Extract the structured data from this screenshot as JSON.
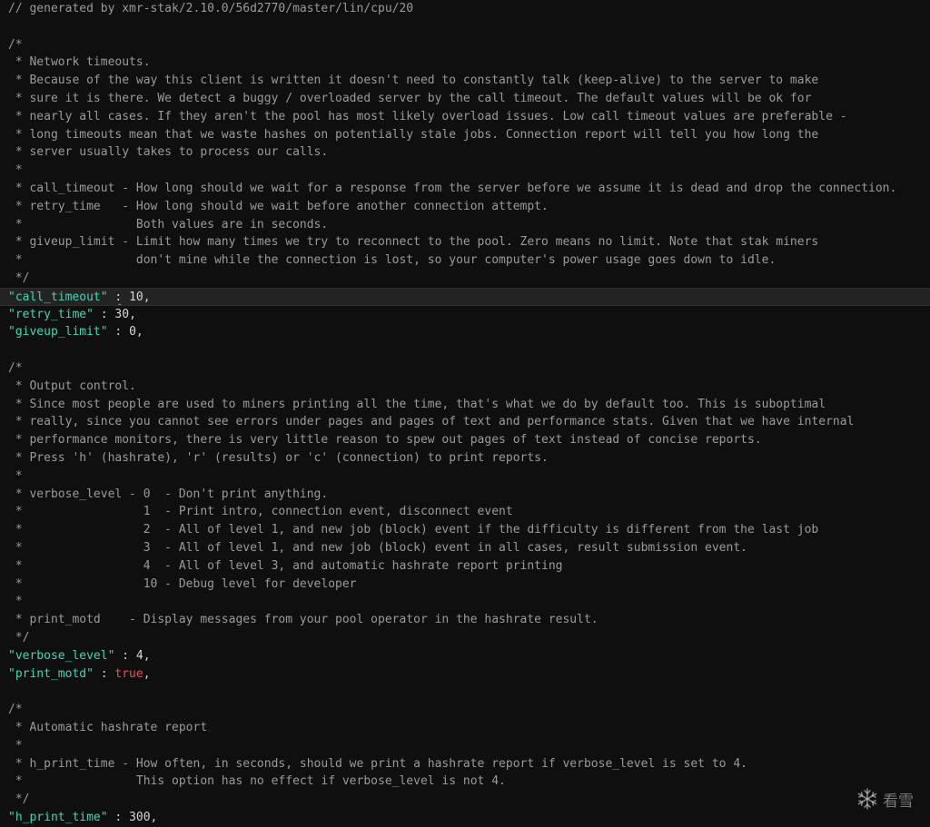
{
  "lines": [
    {
      "y": 0,
      "parts": [
        {
          "cls": "cmt",
          "text": "// generated by xmr-stak/2.10.0/56d2770/master/lin/cpu/20"
        }
      ]
    },
    {
      "y": 2,
      "parts": [
        {
          "cls": "cmt",
          "text": "/*"
        }
      ]
    },
    {
      "y": 3,
      "parts": [
        {
          "cls": "cmt",
          "text": " * Network timeouts."
        }
      ]
    },
    {
      "y": 4,
      "parts": [
        {
          "cls": "cmt",
          "text": " * Because of the way this client is written it doesn't need to constantly talk (keep-alive) to the server to make"
        }
      ]
    },
    {
      "y": 5,
      "parts": [
        {
          "cls": "cmt",
          "text": " * sure it is there. We detect a buggy / overloaded server by the call timeout. The default values will be ok for"
        }
      ]
    },
    {
      "y": 6,
      "parts": [
        {
          "cls": "cmt",
          "text": " * nearly all cases. If they aren't the pool has most likely overload issues. Low call timeout values are preferable -"
        }
      ]
    },
    {
      "y": 7,
      "parts": [
        {
          "cls": "cmt",
          "text": " * long timeouts mean that we waste hashes on potentially stale jobs. Connection report will tell you how long the"
        }
      ]
    },
    {
      "y": 8,
      "parts": [
        {
          "cls": "cmt",
          "text": " * server usually takes to process our calls."
        }
      ]
    },
    {
      "y": 9,
      "parts": [
        {
          "cls": "cmt",
          "text": " *"
        }
      ]
    },
    {
      "y": 10,
      "parts": [
        {
          "cls": "cmt",
          "text": " * call_timeout - How long should we wait for a response from the server before we assume it is dead and drop the connection."
        }
      ]
    },
    {
      "y": 11,
      "parts": [
        {
          "cls": "cmt",
          "text": " * retry_time   - How long should we wait before another connection attempt."
        }
      ]
    },
    {
      "y": 12,
      "parts": [
        {
          "cls": "cmt",
          "text": " *                Both values are in seconds."
        }
      ]
    },
    {
      "y": 13,
      "parts": [
        {
          "cls": "cmt",
          "text": " * giveup_limit - Limit how many times we try to reconnect to the pool. Zero means no limit. Note that stak miners"
        }
      ]
    },
    {
      "y": 14,
      "parts": [
        {
          "cls": "cmt",
          "text": " *                don't mine while the connection is lost, so your computer's power usage goes down to idle."
        }
      ]
    },
    {
      "y": 15,
      "parts": [
        {
          "cls": "cmt",
          "text": " */"
        }
      ]
    },
    {
      "y": 16,
      "highlight": true,
      "parts": [
        {
          "cls": "key",
          "text": "\"call_timeout\""
        },
        {
          "cls": "punc",
          "text": " "
        },
        {
          "cls": "punc cursor-underline",
          "text": ":"
        },
        {
          "cls": "punc",
          "text": " "
        },
        {
          "cls": "num",
          "text": "10"
        },
        {
          "cls": "punc",
          "text": ","
        }
      ]
    },
    {
      "y": 17,
      "parts": [
        {
          "cls": "key",
          "text": "\"retry_time\""
        },
        {
          "cls": "punc",
          "text": " : "
        },
        {
          "cls": "num",
          "text": "30"
        },
        {
          "cls": "punc",
          "text": ","
        }
      ]
    },
    {
      "y": 18,
      "parts": [
        {
          "cls": "key",
          "text": "\"giveup_limit\""
        },
        {
          "cls": "punc",
          "text": " : "
        },
        {
          "cls": "num",
          "text": "0"
        },
        {
          "cls": "punc",
          "text": ","
        }
      ]
    },
    {
      "y": 20,
      "parts": [
        {
          "cls": "cmt",
          "text": "/*"
        }
      ]
    },
    {
      "y": 21,
      "parts": [
        {
          "cls": "cmt",
          "text": " * Output control."
        }
      ]
    },
    {
      "y": 22,
      "parts": [
        {
          "cls": "cmt",
          "text": " * Since most people are used to miners printing all the time, that's what we do by default too. This is suboptimal"
        }
      ]
    },
    {
      "y": 23,
      "parts": [
        {
          "cls": "cmt",
          "text": " * really, since you cannot see errors under pages and pages of text and performance stats. Given that we have internal"
        }
      ]
    },
    {
      "y": 24,
      "parts": [
        {
          "cls": "cmt",
          "text": " * performance monitors, there is very little reason to spew out pages of text instead of concise reports."
        }
      ]
    },
    {
      "y": 25,
      "parts": [
        {
          "cls": "cmt",
          "text": " * Press 'h' (hashrate), 'r' (results) or 'c' (connection) to print reports."
        }
      ]
    },
    {
      "y": 26,
      "parts": [
        {
          "cls": "cmt",
          "text": " *"
        }
      ]
    },
    {
      "y": 27,
      "parts": [
        {
          "cls": "cmt",
          "text": " * verbose_level - 0  - Don't print anything."
        }
      ]
    },
    {
      "y": 28,
      "parts": [
        {
          "cls": "cmt",
          "text": " *                 1  - Print intro, connection event, disconnect event"
        }
      ]
    },
    {
      "y": 29,
      "parts": [
        {
          "cls": "cmt",
          "text": " *                 2  - All of level 1, and new job (block) event if the difficulty is different from the last job"
        }
      ]
    },
    {
      "y": 30,
      "parts": [
        {
          "cls": "cmt",
          "text": " *                 3  - All of level 1, and new job (block) event in all cases, result submission event."
        }
      ]
    },
    {
      "y": 31,
      "parts": [
        {
          "cls": "cmt",
          "text": " *                 4  - All of level 3, and automatic hashrate report printing"
        }
      ]
    },
    {
      "y": 32,
      "parts": [
        {
          "cls": "cmt",
          "text": " *                 10 - Debug level for developer"
        }
      ]
    },
    {
      "y": 33,
      "parts": [
        {
          "cls": "cmt",
          "text": " *"
        }
      ]
    },
    {
      "y": 34,
      "parts": [
        {
          "cls": "cmt",
          "text": " * print_motd    - Display messages from your pool operator in the hashrate result."
        }
      ]
    },
    {
      "y": 35,
      "parts": [
        {
          "cls": "cmt",
          "text": " */"
        }
      ]
    },
    {
      "y": 36,
      "parts": [
        {
          "cls": "key",
          "text": "\"verbose_level\""
        },
        {
          "cls": "punc",
          "text": " : "
        },
        {
          "cls": "num",
          "text": "4"
        },
        {
          "cls": "punc",
          "text": ","
        }
      ]
    },
    {
      "y": 37,
      "parts": [
        {
          "cls": "key",
          "text": "\"print_motd\""
        },
        {
          "cls": "punc",
          "text": " : "
        },
        {
          "cls": "bool",
          "text": "true"
        },
        {
          "cls": "punc",
          "text": ","
        }
      ]
    },
    {
      "y": 39,
      "parts": [
        {
          "cls": "cmt",
          "text": "/*"
        }
      ]
    },
    {
      "y": 40,
      "parts": [
        {
          "cls": "cmt",
          "text": " * Automatic hashrate report"
        }
      ]
    },
    {
      "y": 41,
      "parts": [
        {
          "cls": "cmt",
          "text": " *"
        }
      ]
    },
    {
      "y": 42,
      "parts": [
        {
          "cls": "cmt",
          "text": " * h_print_time - How often, in seconds, should we print a hashrate report if verbose_level is set to 4."
        }
      ]
    },
    {
      "y": 43,
      "parts": [
        {
          "cls": "cmt",
          "text": " *                This option has no effect if verbose_level is not 4."
        }
      ]
    },
    {
      "y": 44,
      "parts": [
        {
          "cls": "cmt",
          "text": " */"
        }
      ]
    },
    {
      "y": 45,
      "parts": [
        {
          "cls": "key",
          "text": "\"h_print_time\""
        },
        {
          "cls": "punc",
          "text": " : "
        },
        {
          "cls": "num",
          "text": "300"
        },
        {
          "cls": "punc",
          "text": ","
        }
      ]
    }
  ],
  "watermark": {
    "icon": "snowflake-icon",
    "text": "看雪"
  }
}
